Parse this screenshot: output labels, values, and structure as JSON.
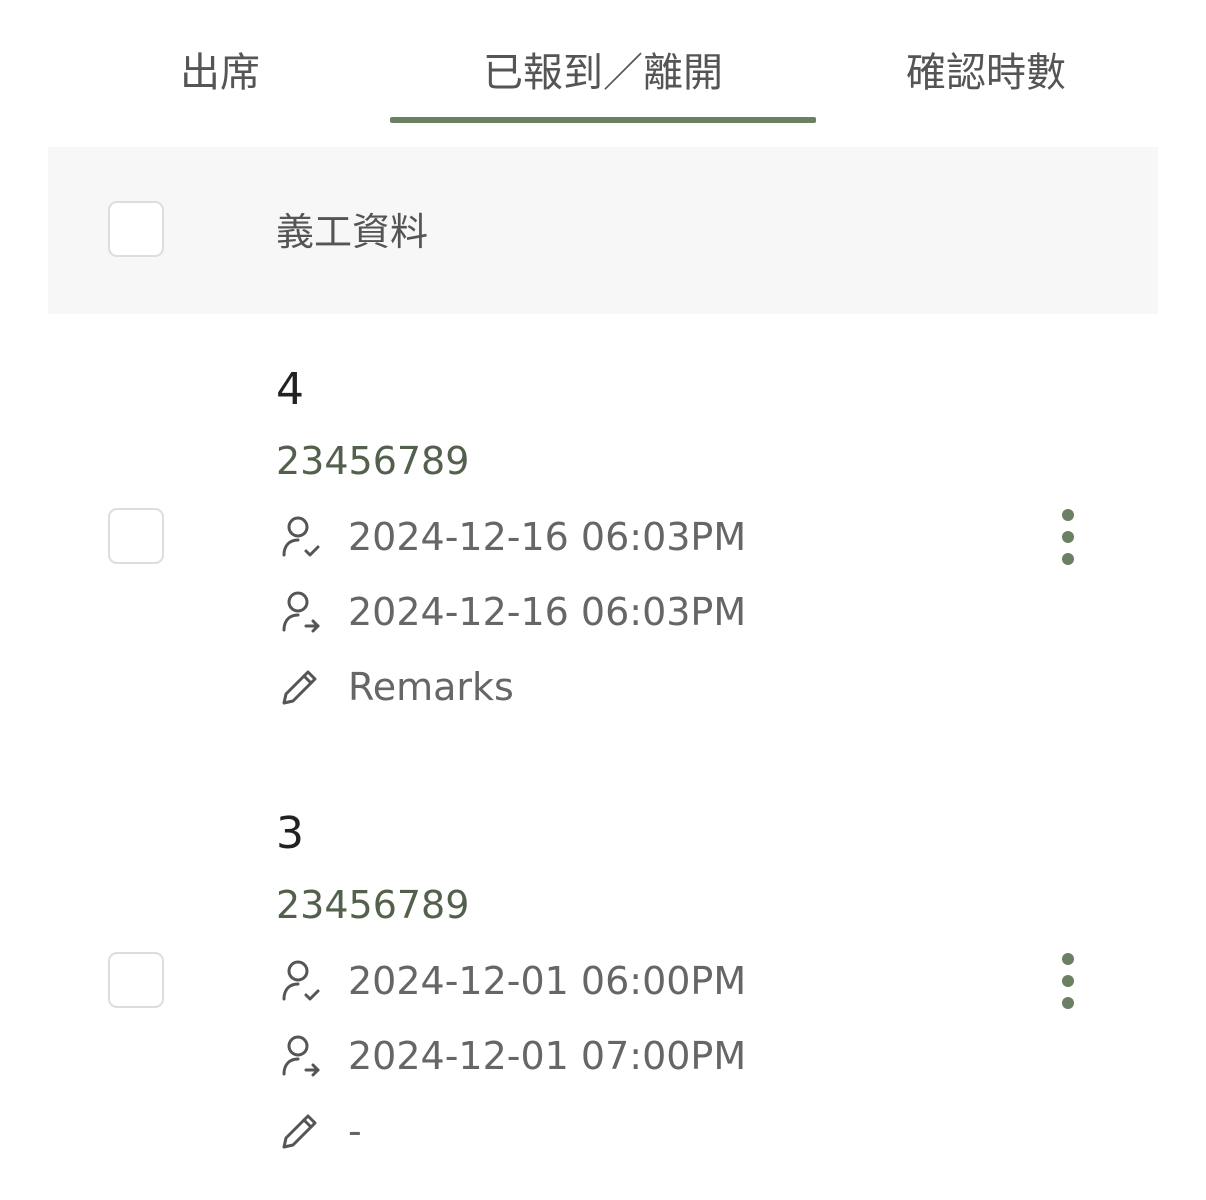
{
  "tabs": [
    {
      "label": "出席"
    },
    {
      "label": "已報到／離開"
    },
    {
      "label": "確認時數"
    }
  ],
  "table_header": {
    "label": "義工資料"
  },
  "records": [
    {
      "name": "4",
      "phone": "23456789",
      "check_in": "2024-12-16 06:03PM",
      "check_out": "2024-12-16 06:03PM",
      "remarks": "Remarks"
    },
    {
      "name": "3",
      "phone": "23456789",
      "check_in": "2024-12-01 06:00PM",
      "check_out": "2024-12-01 07:00PM",
      "remarks": "-"
    }
  ],
  "colors": {
    "accent": "#6b7f63",
    "phone": "#52604c"
  }
}
